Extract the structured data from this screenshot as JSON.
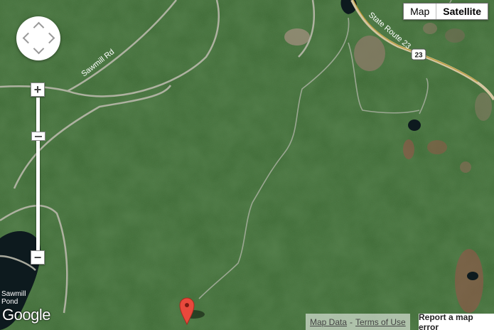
{
  "map_type": {
    "map_label": "Map",
    "satellite_label": "Satellite",
    "active": "Satellite"
  },
  "labels": {
    "road_sawmill": "Sawmill Rd",
    "road_state": "State Route 23",
    "route_shield": "23",
    "pond": "Sawmill Pond"
  },
  "branding": {
    "logo": "Google"
  },
  "footer": {
    "map_data": "Map Data",
    "separator": "-",
    "terms": "Terms of Use",
    "report": "Report a map error"
  },
  "controls": {
    "zoom_in": "+",
    "zoom_out": "−",
    "pan_icon": "pan-control",
    "marker_icon": "map-pin-icon"
  },
  "colors": {
    "forest": "#3f6a33",
    "marker": "#e8493c",
    "water": "#0d1a1e"
  }
}
